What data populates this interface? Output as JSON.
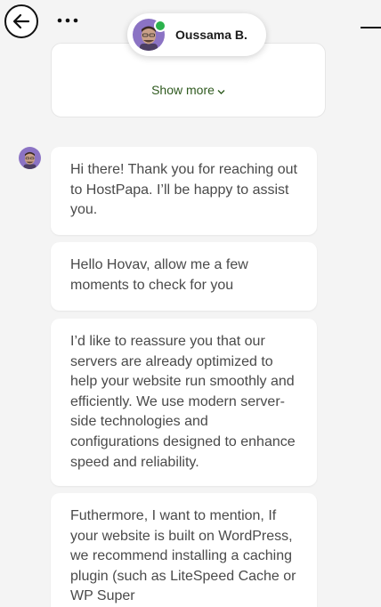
{
  "header": {
    "agent_name": "Oussama B.",
    "status_color": "#2bb24c",
    "back_icon": "arrow-left-icon",
    "more_icon": "more-horizontal-icon",
    "minimize_icon": "minimize-icon"
  },
  "previous_card": {
    "show_more_label": "Show more",
    "link_color": "#2f5a1f"
  },
  "messages": [
    {
      "text": "Hi there! Thank you for reaching out to HostPapa. I’ll be happy to assist you."
    },
    {
      "text": "Hello Hovav, allow me a few moments to check for you"
    },
    {
      "text": "I’d like to reassure you that our servers are already optimized to help your website run smoothly and efficiently. We use modern server-side technologies and configurations designed to enhance speed and reliability."
    },
    {
      "text": "Futhermore, I want to mention, If your website is built on WordPress, we recommend installing a caching plugin (such as LiteSpeed Cache or WP Super"
    }
  ]
}
